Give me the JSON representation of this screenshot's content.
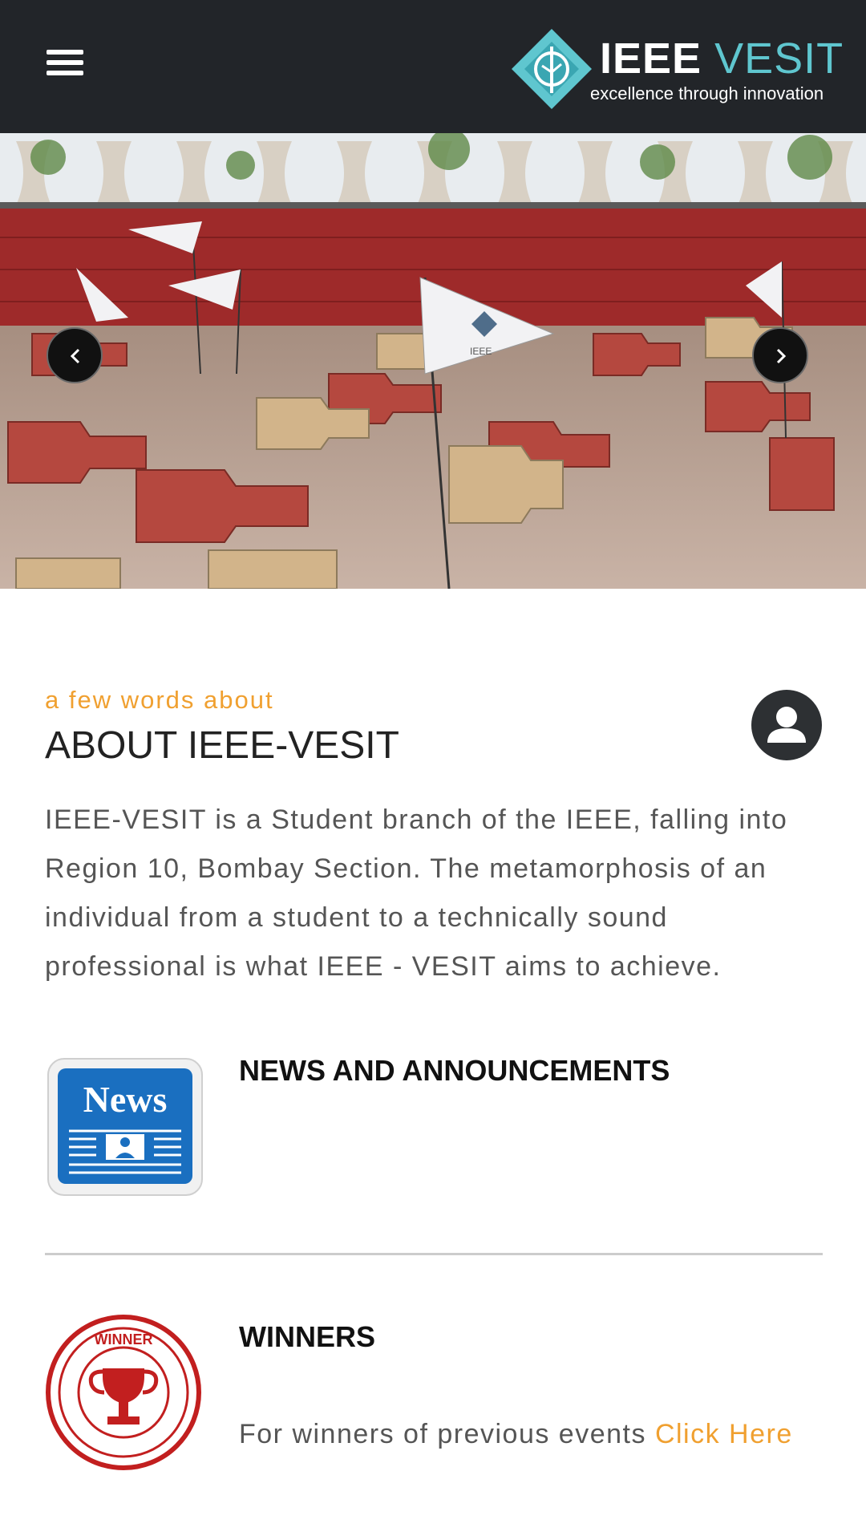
{
  "header": {
    "menu_icon": "hamburger-menu-icon",
    "logo": {
      "word_ieee": "IEEE",
      "word_vesit": "VESIT",
      "tagline": "excellence through innovation"
    }
  },
  "carousel": {
    "prev_icon": "chevron-left-icon",
    "next_icon": "chevron-right-icon",
    "flag_text": "IEEE"
  },
  "about": {
    "subtitle": "a few words about",
    "title": "ABOUT IEEE-VESIT",
    "icon": "user-icon",
    "body": "IEEE-VESIT is a Student branch of the IEEE, falling into Region 10, Bombay Section. The metamorphosis of an individual from a student to a technically sound professional is what IEEE - VESIT aims to achieve."
  },
  "news": {
    "icon_label": "News",
    "title": "NEWS AND ANNOUNCEMENTS"
  },
  "winners": {
    "stamp_text": "WINNER",
    "title": "WINNERS",
    "text": "For winners of previous events ",
    "link": "Click Here"
  },
  "colors": {
    "header_bg": "#222529",
    "accent_orange": "#f0a030",
    "logo_teal": "#5fc6cf",
    "news_blue": "#1a6fc0",
    "winner_red": "#c21f1f"
  }
}
